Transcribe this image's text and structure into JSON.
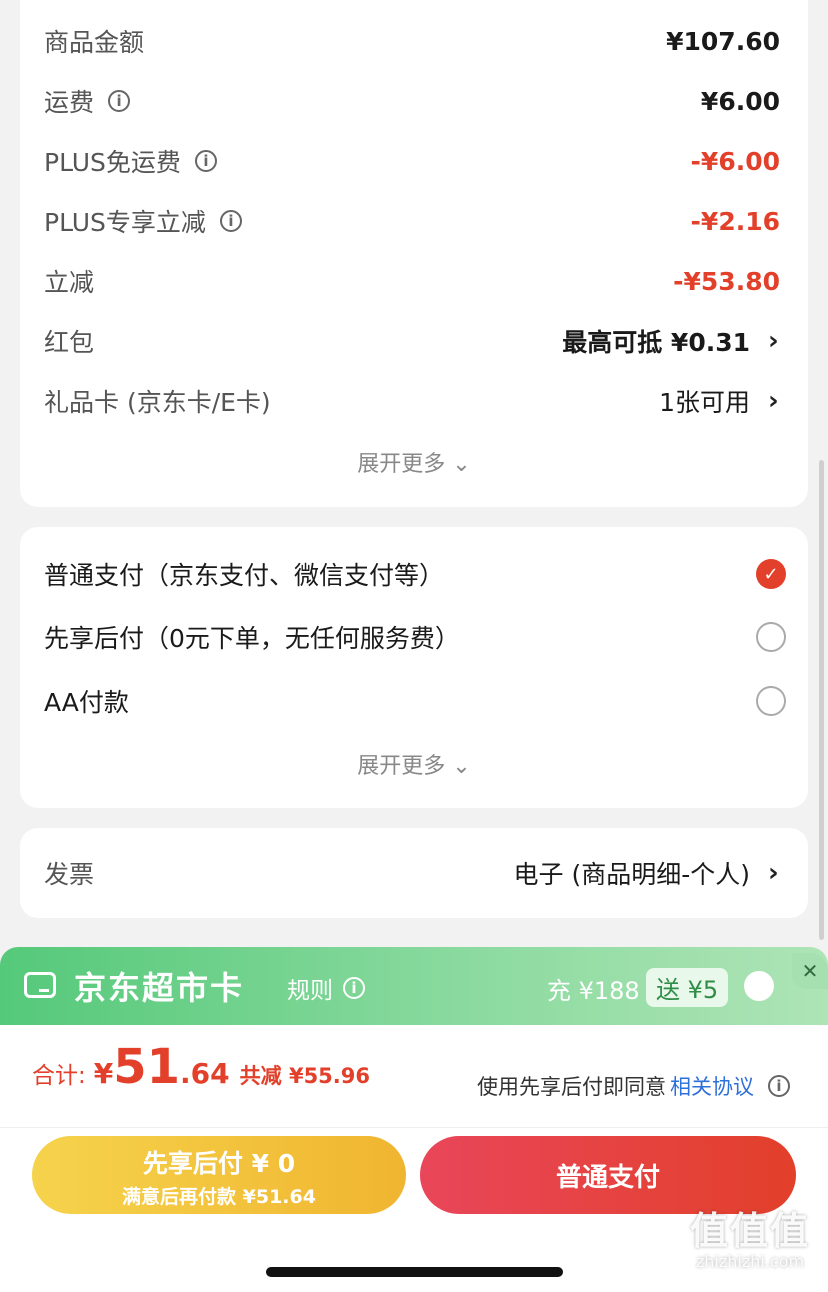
{
  "summary": {
    "rows": [
      {
        "label": "商品金额",
        "value": "¥107.60",
        "info": false,
        "red": false,
        "chevron": false
      },
      {
        "label": "运费",
        "value": "¥6.00",
        "info": true,
        "red": false,
        "chevron": false
      },
      {
        "label": "PLUS免运费",
        "value": "-¥6.00",
        "info": true,
        "red": true,
        "chevron": false
      },
      {
        "label": "PLUS专享立减",
        "value": "-¥2.16",
        "info": true,
        "red": true,
        "chevron": false
      },
      {
        "label": "立减",
        "value": "-¥53.80",
        "info": false,
        "red": true,
        "chevron": false
      },
      {
        "label": "红包",
        "value": "最高可抵 ¥0.31",
        "info": false,
        "red": false,
        "chevron": true
      },
      {
        "label": "礼品卡 (京东卡/E卡)",
        "value": "1张可用",
        "info": false,
        "red": false,
        "chevron": true
      }
    ],
    "expand_label": "展开更多"
  },
  "payment": {
    "options": [
      {
        "label": "普通支付（京东支付、微信支付等）",
        "selected": true
      },
      {
        "label": "先享后付（0元下单，无任何服务费）",
        "selected": false
      },
      {
        "label": "AA付款",
        "selected": false
      }
    ],
    "expand_label": "展开更多"
  },
  "invoice": {
    "label": "发票",
    "value": "电子 (商品明细-个人)"
  },
  "promo": {
    "title": "京东超市卡",
    "rules": "规则",
    "charge": "充 ¥188",
    "bonus": "送 ¥5",
    "close": "✕"
  },
  "total": {
    "label": "合计:",
    "currency": "¥",
    "amount_int": "51",
    "amount_dec": ".64",
    "saved": "共减 ¥55.96",
    "agree_prefix": "使用先享后付即同意",
    "agree_link": "相关协议"
  },
  "buttons": {
    "bnpl_title": "先享后付 ¥ 0",
    "bnpl_sub": "满意后再付款 ¥51.64",
    "pay": "普通支付"
  },
  "watermark": {
    "logo": "值值值",
    "site": "zhizhizhi.com"
  },
  "colors": {
    "accent_red": "#e2402a",
    "green": "#55c97a",
    "bnpl_yellow": "#f3c23f",
    "link_blue": "#2e6fd8"
  }
}
